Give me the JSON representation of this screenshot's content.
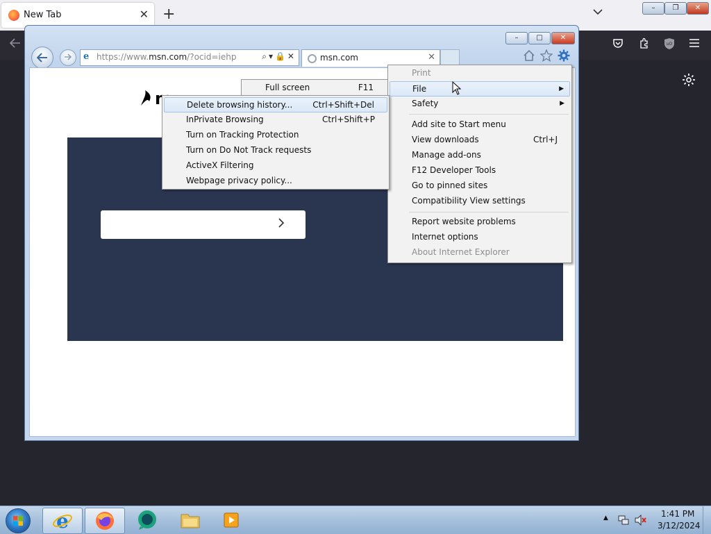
{
  "firefox": {
    "tab_title": "New Tab",
    "tab_close": "✕",
    "new_tab": "+",
    "caption": {
      "minimize": "–",
      "restore": "❐",
      "close": "✕"
    }
  },
  "ie": {
    "address": {
      "scheme": "https://www.",
      "domain": "msn.com",
      "path": "/?ocid=iehp",
      "tools": "⌕▾🔒✕"
    },
    "tab": {
      "title": "msn.com",
      "close": "✕"
    },
    "caption": {
      "minimize": "–",
      "maximize": "□",
      "close": "✕"
    },
    "msn_logo_partial": "m"
  },
  "tools_menu": {
    "items": [
      {
        "label": "Print",
        "disabled": true
      },
      {
        "label": "File",
        "submenu": true,
        "highlighted": true
      },
      {
        "label": "Safety",
        "submenu": true
      },
      {
        "label": "Add site to Start menu"
      },
      {
        "label": "View downloads",
        "shortcut": "Ctrl+J"
      },
      {
        "label": "Manage add-ons"
      },
      {
        "label": "F12 Developer Tools"
      },
      {
        "label": "Go to pinned sites"
      },
      {
        "label": "Compatibility View settings"
      },
      {
        "label": "Report website problems"
      },
      {
        "label": "Internet options"
      },
      {
        "label": "About Internet Explorer",
        "disabled": true
      }
    ]
  },
  "file_submenu_peek": {
    "label": "Full screen",
    "shortcut": "F11"
  },
  "safety_submenu": {
    "items": [
      {
        "label": "Delete browsing history...",
        "shortcut": "Ctrl+Shift+Del",
        "highlighted": true
      },
      {
        "label": "InPrivate Browsing",
        "shortcut": "Ctrl+Shift+P"
      },
      {
        "label": "Turn on Tracking Protection"
      },
      {
        "label": "Turn on Do Not Track requests"
      },
      {
        "label": "ActiveX Filtering"
      },
      {
        "label": "Webpage privacy policy..."
      }
    ]
  },
  "taskbar": {
    "time": "1:41 PM",
    "date": "3/12/2024",
    "tray_show_hidden": "▲"
  },
  "colors": {
    "msn_hero": "#2a3550",
    "firefox_dark": "#2b2a33",
    "menu_bg": "#f2f2f2"
  }
}
